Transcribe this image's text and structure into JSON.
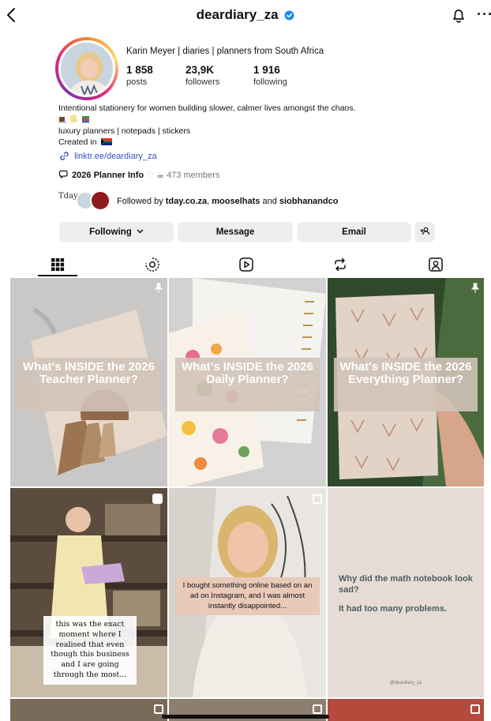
{
  "header": {
    "username": "deardiary_za"
  },
  "profile": {
    "display_name": "Karin Meyer | diaries |  planners from South Africa",
    "stats": [
      {
        "value": "1 858",
        "label": "posts"
      },
      {
        "value": "23,9K",
        "label": "followers"
      },
      {
        "value": "1 916",
        "label": "following"
      }
    ],
    "bio_line1": "Intentional stationery for women building slower, calmer lives amongst the chaos.",
    "bio_line2": "luxury planners | notepads | stickers",
    "bio_line3": "Created in",
    "link": "linktr.ee/deardiary_za",
    "channel_name": "2026 Planner Info",
    "channel_members": "473 members",
    "followed_prefix": "Followed by ",
    "followed_user1": "tday.co.za",
    "followed_sep1": ", ",
    "followed_user2": "mooselhats",
    "followed_sep2": " and ",
    "followed_user3": "siobhanandco",
    "followed_avatar_text": "Tday"
  },
  "actions": {
    "following": "Following",
    "message": "Message",
    "email": "Email"
  },
  "posts": [
    {
      "text": "What's INSIDE the 2026 Teacher Planner?"
    },
    {
      "text": "What's INSIDE the 2026 Daily Planner?"
    },
    {
      "text": "What's INSIDE the 2026 Everything Planner?"
    },
    {
      "text": "this was the exact moment where I realised that even though this business and I are going through the most..."
    },
    {
      "text": "I bought something online based on an ad on Instagram, and I was almost instantly disappointed..."
    },
    {
      "text_q": "Why did the math notebook look sad?",
      "text_a": "It had too many problems.",
      "handle": "@deardiary_za"
    }
  ],
  "colors": {
    "accent_link": "#3a4fbf",
    "verified": "#1d8cf0",
    "pill_overlay": "#cfc0b6"
  }
}
